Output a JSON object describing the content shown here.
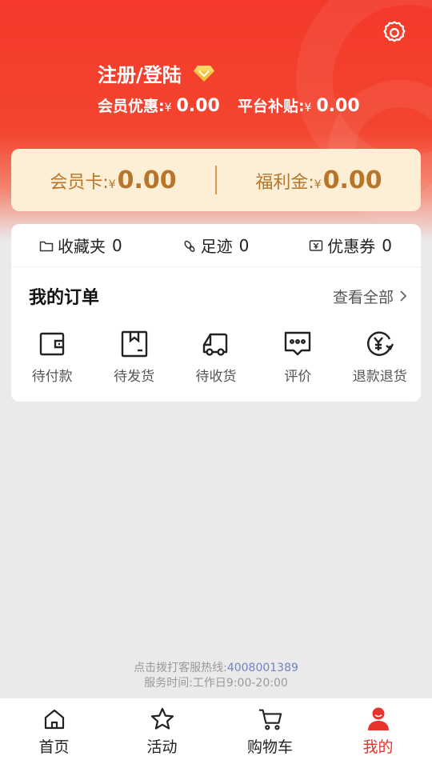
{
  "header": {
    "title": "注册/登陆",
    "member_discount": {
      "label": "会员优惠:",
      "currency": "¥",
      "value": "0.00"
    },
    "platform_subsidy": {
      "label": "平台补贴:",
      "currency": "¥",
      "value": "0.00"
    }
  },
  "member_card": {
    "card": {
      "label": "会员卡:",
      "currency": "¥",
      "value": "0.00"
    },
    "welfare": {
      "label": "福利金:",
      "currency": "¥",
      "value": "0.00"
    }
  },
  "quick": {
    "favorites": {
      "label": "收藏夹",
      "count": "0"
    },
    "footprints": {
      "label": "足迹",
      "count": "0"
    },
    "coupons": {
      "label": "优惠券",
      "count": "0"
    }
  },
  "orders": {
    "title": "我的订单",
    "view_all": "查看全部",
    "items": [
      {
        "label": "待付款",
        "icon": "wallet-icon"
      },
      {
        "label": "待发货",
        "icon": "package-icon"
      },
      {
        "label": "待收货",
        "icon": "truck-icon"
      },
      {
        "label": "评价",
        "icon": "comment-icon"
      },
      {
        "label": "退款退货",
        "icon": "refund-icon"
      }
    ]
  },
  "hotline": {
    "prefix": "点击拨打客服热线:",
    "number": "4008001389",
    "hours": "服务时间:工作日9:00-20:00"
  },
  "tabs": [
    {
      "label": "首页",
      "icon": "home-icon"
    },
    {
      "label": "活动",
      "icon": "star-icon"
    },
    {
      "label": "购物车",
      "icon": "cart-icon"
    },
    {
      "label": "我的",
      "icon": "user-icon",
      "active": true
    }
  ],
  "colors": {
    "brand_red": "#f4392a",
    "card_bg": "#fcefd6",
    "card_text": "#b8752a",
    "active_tab": "#e8322a",
    "hotline_number": "#6b86c0"
  }
}
